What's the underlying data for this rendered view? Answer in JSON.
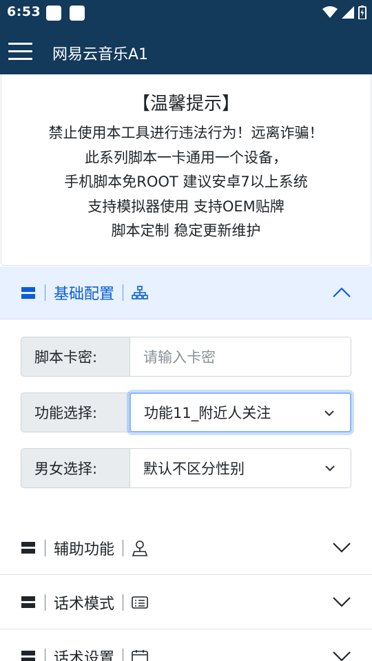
{
  "status_bar": {
    "time": "6:53",
    "icons": [
      "notification-app-icon",
      "notification-app-icon",
      "wifi-icon",
      "signal-icon",
      "battery-icon"
    ]
  },
  "app_bar": {
    "title": "网易云音乐A1",
    "menu_icon": "hamburger-menu-icon"
  },
  "notice": {
    "title": "【温馨提示】",
    "lines": [
      "禁止使用本工具进行违法行为！远离诈骗！",
      "此系列脚本一卡通用一个设备，",
      "手机脚本免ROOT 建议安卓7以上系统",
      "支持模拟器使用 支持OEM贴牌",
      "脚本定制 稳定更新维护"
    ]
  },
  "sections": [
    {
      "label": "基础配置",
      "icon": "sitemap-icon",
      "expanded": true
    },
    {
      "label": "辅助功能",
      "icon": "person-icon",
      "expanded": false
    },
    {
      "label": "话术模式",
      "icon": "card-list-icon",
      "expanded": false
    },
    {
      "label": "话术设置",
      "icon": "calendar-icon",
      "expanded": false
    }
  ],
  "basic_config": {
    "card_key": {
      "label": "脚本卡密:",
      "placeholder": "请输入卡密",
      "value": ""
    },
    "function_select": {
      "label": "功能选择:",
      "selected": "功能11_附近人关注"
    },
    "gender_select": {
      "label": "男女选择:",
      "selected": "默认不区分性别"
    }
  },
  "colors": {
    "app_bar": "#13395b",
    "accordion_active_bg": "#e7f1ff",
    "accordion_active_text": "#0b5ed7",
    "label_bg": "#e9ecef"
  }
}
